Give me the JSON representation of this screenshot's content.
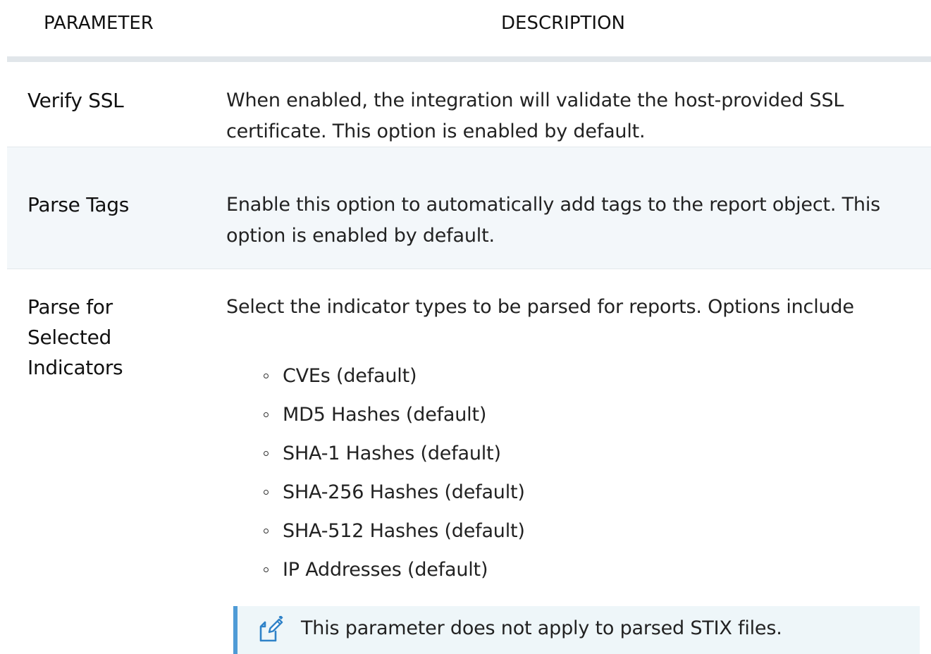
{
  "header": {
    "parameter": "PARAMETER",
    "description": "DESCRIPTION"
  },
  "rows": [
    {
      "parameter": "Verify SSL",
      "description": "When enabled, the integration will validate the host-provided SSL certificate.  This option is enabled by default."
    },
    {
      "parameter": "Parse Tags",
      "description": "Enable this option to automatically add tags to the report object. This option is enabled by default."
    },
    {
      "parameter": "Parse for Selected Indicators",
      "description": "Select the indicator types to be parsed for reports.  Options include",
      "options": [
        "CVEs (default)",
        "MD5 Hashes (default)",
        "SHA-1 Hashes (default)",
        "SHA-256 Hashes (default)",
        "SHA-512 Hashes (default)",
        "IP Addresses (default)"
      ],
      "note": {
        "icon": "note-edit-icon",
        "text": "This parameter does not apply to parsed STIX files."
      }
    }
  ],
  "colors": {
    "header_rule": "#e1e6ea",
    "alt_row": "#f3f7fa",
    "note_background": "#eef6f9",
    "note_accent": "#4e9bd6"
  }
}
